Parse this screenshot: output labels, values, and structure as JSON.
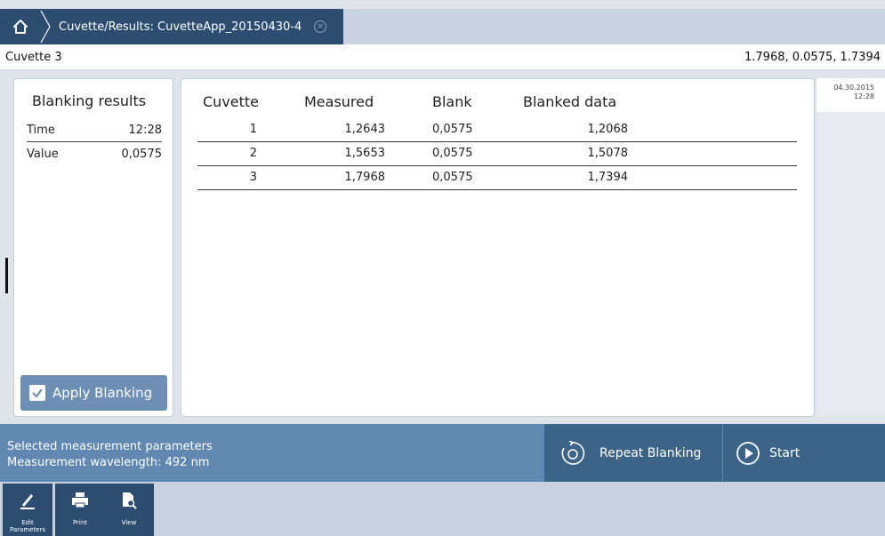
{
  "window": {
    "tab_title": "Cuvette/Results: CuvetteApp_20150430-4",
    "close_glyph": "×"
  },
  "subheader": {
    "cuvette_label": "Cuvette 3",
    "readout": "1.7968, 0.0575, 1.7394"
  },
  "blanking": {
    "title": "Blanking results",
    "rows": [
      {
        "key": "Time",
        "value": "12:28"
      },
      {
        "key": "Value",
        "value": "0,0575"
      }
    ],
    "apply_button": "Apply Blanking"
  },
  "results": {
    "headers": [
      "Cuvette",
      "Measured",
      "Blank",
      "Blanked data"
    ],
    "rows": [
      [
        "1",
        "1,2643",
        "0,0575",
        "1,2068"
      ],
      [
        "2",
        "1,5653",
        "0,0575",
        "1,5078"
      ],
      [
        "3",
        "1,7968",
        "0,0575",
        "1,7394"
      ]
    ]
  },
  "mini_panel": {
    "date": "04.30.2015",
    "time": "12:28"
  },
  "bottom": {
    "params_title": "Selected measurement parameters",
    "params_wavelength": "Measurement wavelength: 492 nm",
    "repeat_button": "Repeat Blanking",
    "start_button": "Start"
  },
  "toolbar": {
    "edit_line1": "Edit",
    "edit_line2": "Parameters",
    "print": "Print",
    "view": "View"
  },
  "icons": {
    "home": "home-icon",
    "repeat": "refresh-icon",
    "start": "play-icon",
    "edit": "pencil-icon",
    "print": "printer-icon",
    "view": "view-document-icon",
    "check": "checkbox-icon"
  },
  "colors": {
    "accent_dark": "#2d4d70",
    "bottom_bar": "#6088b0",
    "action_button": "#3c6487",
    "apply_button": "#6d8fb3"
  }
}
